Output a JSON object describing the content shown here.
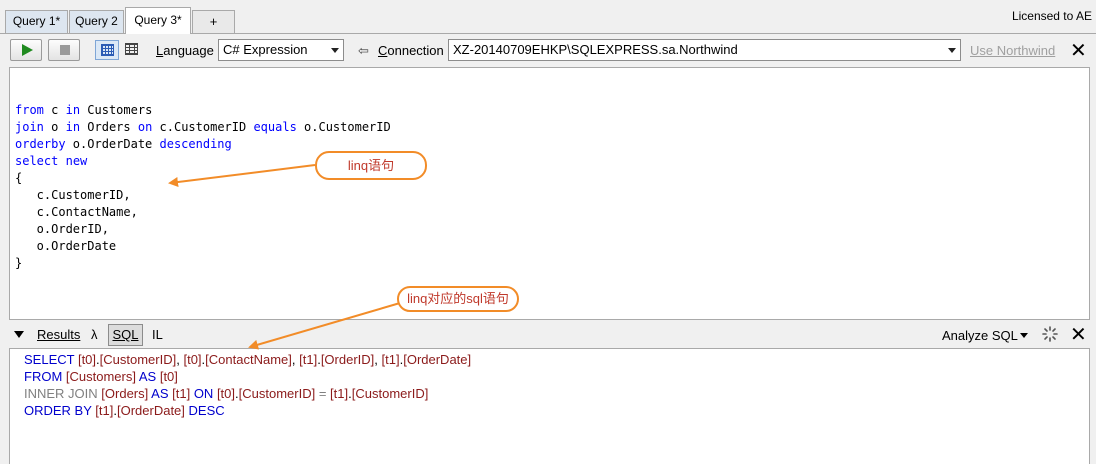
{
  "tabs": [
    {
      "label": "Query 1*"
    },
    {
      "label": "Query 2"
    },
    {
      "label": "Query 3*"
    },
    {
      "label": "+"
    }
  ],
  "license_text": "Licensed to AE",
  "toolbar": {
    "language_label": "Language",
    "language_value": "C# Expression",
    "connection_label": "Connection",
    "connection_value": "XZ-20140709EHKP\\SQLEXPRESS.sa.Northwind",
    "use_northwind": "Use Northwind"
  },
  "editor": {
    "lines": [
      [
        {
          "t": "from",
          "k": "kw"
        },
        {
          "t": " c ",
          "k": "id"
        },
        {
          "t": "in",
          "k": "kw"
        },
        {
          "t": " Customers",
          "k": "id"
        }
      ],
      [
        {
          "t": "join",
          "k": "kw"
        },
        {
          "t": " o ",
          "k": "id"
        },
        {
          "t": "in",
          "k": "kw"
        },
        {
          "t": " Orders ",
          "k": "id"
        },
        {
          "t": "on",
          "k": "kw"
        },
        {
          "t": " c.CustomerID ",
          "k": "id"
        },
        {
          "t": "equals",
          "k": "kw"
        },
        {
          "t": " o.CustomerID",
          "k": "id"
        }
      ],
      [
        {
          "t": "orderby",
          "k": "kw"
        },
        {
          "t": " o.OrderDate ",
          "k": "id"
        },
        {
          "t": "descending",
          "k": "kw"
        }
      ],
      [
        {
          "t": "select",
          "k": "kw"
        },
        {
          "t": " ",
          "k": "id"
        },
        {
          "t": "new",
          "k": "kw"
        }
      ],
      [
        {
          "t": "{",
          "k": "id"
        }
      ],
      [
        {
          "t": "   c.CustomerID,",
          "k": "id"
        }
      ],
      [
        {
          "t": "   c.ContactName,",
          "k": "id"
        }
      ],
      [
        {
          "t": "   o.OrderID,",
          "k": "id"
        }
      ],
      [
        {
          "t": "   o.OrderDate",
          "k": "id"
        }
      ],
      [
        {
          "t": "}",
          "k": "id"
        }
      ]
    ]
  },
  "annotations": {
    "linq_label": "linq语句",
    "sql_label": "linq对应的sql语句"
  },
  "results_bar": {
    "results_label": "Results",
    "lambda_label": "λ",
    "sql_label": "SQL",
    "il_label": "IL",
    "analyze_label": "Analyze SQL"
  },
  "sql": {
    "lines": [
      [
        {
          "t": "SELECT ",
          "k": "skw"
        },
        {
          "t": "[t0]",
          "k": "sid"
        },
        {
          "t": ".",
          "k": "sop"
        },
        {
          "t": "[CustomerID]",
          "k": "sid"
        },
        {
          "t": ", ",
          "k": "sop"
        },
        {
          "t": "[t0]",
          "k": "sid"
        },
        {
          "t": ".",
          "k": "sop"
        },
        {
          "t": "[ContactName]",
          "k": "sid"
        },
        {
          "t": ", ",
          "k": "sop"
        },
        {
          "t": "[t1]",
          "k": "sid"
        },
        {
          "t": ".",
          "k": "sop"
        },
        {
          "t": "[OrderID]",
          "k": "sid"
        },
        {
          "t": ", ",
          "k": "sop"
        },
        {
          "t": "[t1]",
          "k": "sid"
        },
        {
          "t": ".",
          "k": "sop"
        },
        {
          "t": "[OrderDate]",
          "k": "sid"
        }
      ],
      [
        {
          "t": "FROM ",
          "k": "skw"
        },
        {
          "t": "[Customers]",
          "k": "sid"
        },
        {
          "t": " AS ",
          "k": "skw"
        },
        {
          "t": "[t0]",
          "k": "sid"
        }
      ],
      [
        {
          "t": "INNER JOIN ",
          "k": "sgray"
        },
        {
          "t": "[Orders]",
          "k": "sid"
        },
        {
          "t": " AS ",
          "k": "skw"
        },
        {
          "t": "[t1]",
          "k": "sid"
        },
        {
          "t": " ON ",
          "k": "skw"
        },
        {
          "t": "[t0]",
          "k": "sid"
        },
        {
          "t": ".",
          "k": "sop"
        },
        {
          "t": "[CustomerID]",
          "k": "sid"
        },
        {
          "t": " = ",
          "k": "sgray"
        },
        {
          "t": "[t1]",
          "k": "sid"
        },
        {
          "t": ".",
          "k": "sop"
        },
        {
          "t": "[CustomerID]",
          "k": "sid"
        }
      ],
      [
        {
          "t": "ORDER BY ",
          "k": "skw"
        },
        {
          "t": "[t1]",
          "k": "sid"
        },
        {
          "t": ".",
          "k": "sop"
        },
        {
          "t": "[OrderDate]",
          "k": "sid"
        },
        {
          "t": " DESC",
          "k": "skw"
        }
      ]
    ]
  }
}
